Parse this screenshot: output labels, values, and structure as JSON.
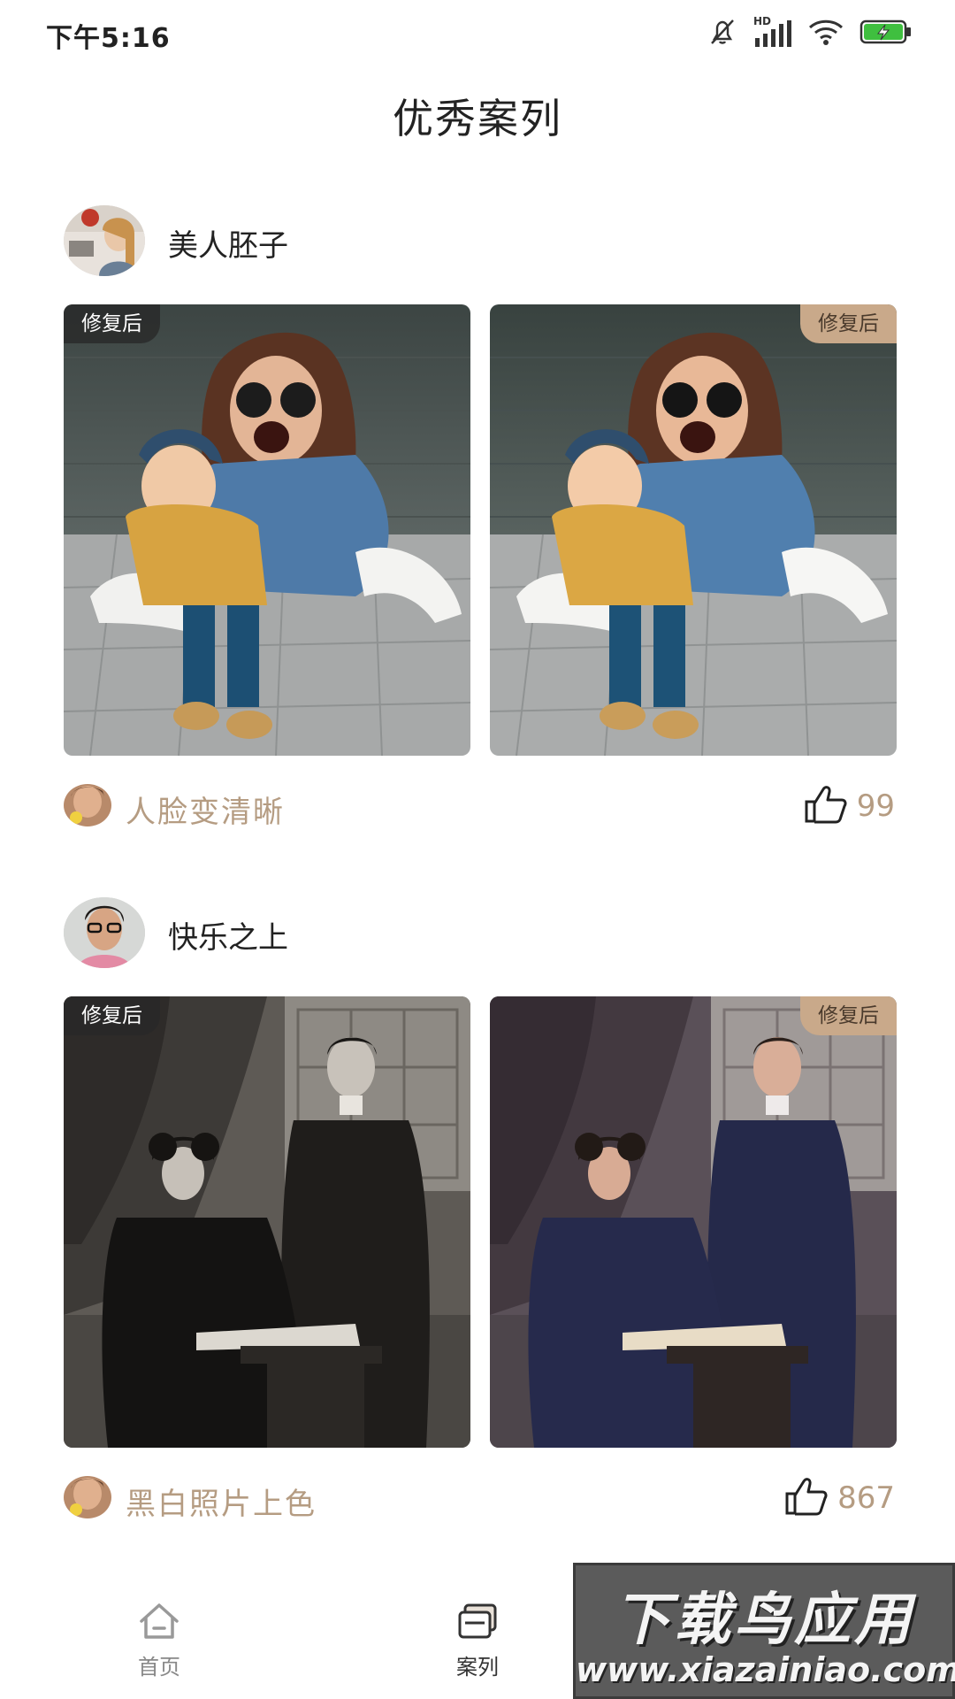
{
  "status_bar": {
    "time": "下午5:16",
    "icons": [
      "mute-bell-icon",
      "hd-signal-icon",
      "wifi-icon",
      "battery-charging-icon"
    ],
    "hd_label": "HD",
    "battery_color": "#3fbf3f"
  },
  "page": {
    "title": "优秀案列"
  },
  "cases": [
    {
      "user_name": "美人胚子",
      "tag_left": "修复后",
      "tag_right": "修复后",
      "feature": "人脸变清晰",
      "likes": "99"
    },
    {
      "user_name": "快乐之上",
      "tag_left": "修复后",
      "tag_right": "修复后",
      "feature": "黑白照片上色",
      "likes": "867"
    }
  ],
  "bottom_nav": {
    "items": [
      {
        "label": "首页",
        "icon": "home-icon",
        "active": false
      },
      {
        "label": "案列",
        "icon": "cases-icon",
        "active": true
      }
    ]
  },
  "watermark": {
    "title": "下载鸟应用",
    "url": "www.xiazainiao.com"
  },
  "colors": {
    "accent": "#b59c82",
    "tag_after_bg": "#c9a98a",
    "tag_before_bg": "#2b2b2b"
  }
}
